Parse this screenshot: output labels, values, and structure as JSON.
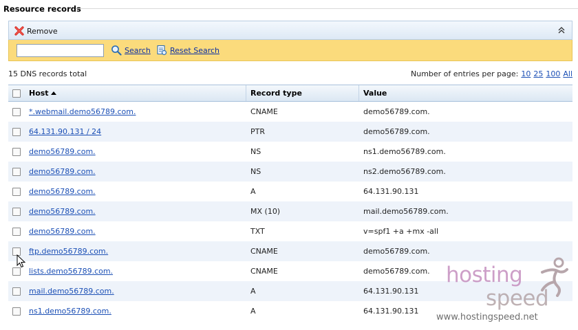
{
  "section": {
    "title": "Resource records"
  },
  "toolbar": {
    "remove_label": "Remove"
  },
  "search": {
    "input_value": "",
    "search_label": "Search",
    "reset_label": "Reset Search"
  },
  "summary": {
    "total": "15 DNS records total",
    "per_page_label": "Number of entries per page:",
    "options": [
      "10",
      "25",
      "100",
      "All"
    ]
  },
  "table": {
    "headers": {
      "host": "Host",
      "type": "Record type",
      "value": "Value"
    },
    "rows": [
      {
        "host": "*.webmail.demo56789.com.",
        "type": "CNAME",
        "value": "demo56789.com."
      },
      {
        "host": "64.131.90.131 / 24",
        "type": "PTR",
        "value": "demo56789.com."
      },
      {
        "host": "demo56789.com.",
        "type": "NS",
        "value": "ns1.demo56789.com."
      },
      {
        "host": "demo56789.com.",
        "type": "NS",
        "value": "ns2.demo56789.com."
      },
      {
        "host": "demo56789.com.",
        "type": "A",
        "value": "64.131.90.131"
      },
      {
        "host": "demo56789.com.",
        "type": "MX (10)",
        "value": "mail.demo56789.com."
      },
      {
        "host": "demo56789.com.",
        "type": "TXT",
        "value": "v=spf1 +a +mx -all"
      },
      {
        "host": "ftp.demo56789.com.",
        "type": "CNAME",
        "value": "demo56789.com."
      },
      {
        "host": "lists.demo56789.com.",
        "type": "CNAME",
        "value": "demo56789.com."
      },
      {
        "host": "mail.demo56789.com.",
        "type": "A",
        "value": "64.131.90.131"
      },
      {
        "host": "ns1.demo56789.com.",
        "type": "A",
        "value": "64.131.90.131"
      }
    ]
  },
  "watermark": {
    "line1": "hosting",
    "line2": "speed",
    "url": "www.hostingspeed.net"
  },
  "colors": {
    "toolbar_bg": "#dde9f5",
    "search_bg": "#fbdb7c",
    "link": "#1b4fb5",
    "row_alt": "#eef3fa"
  }
}
